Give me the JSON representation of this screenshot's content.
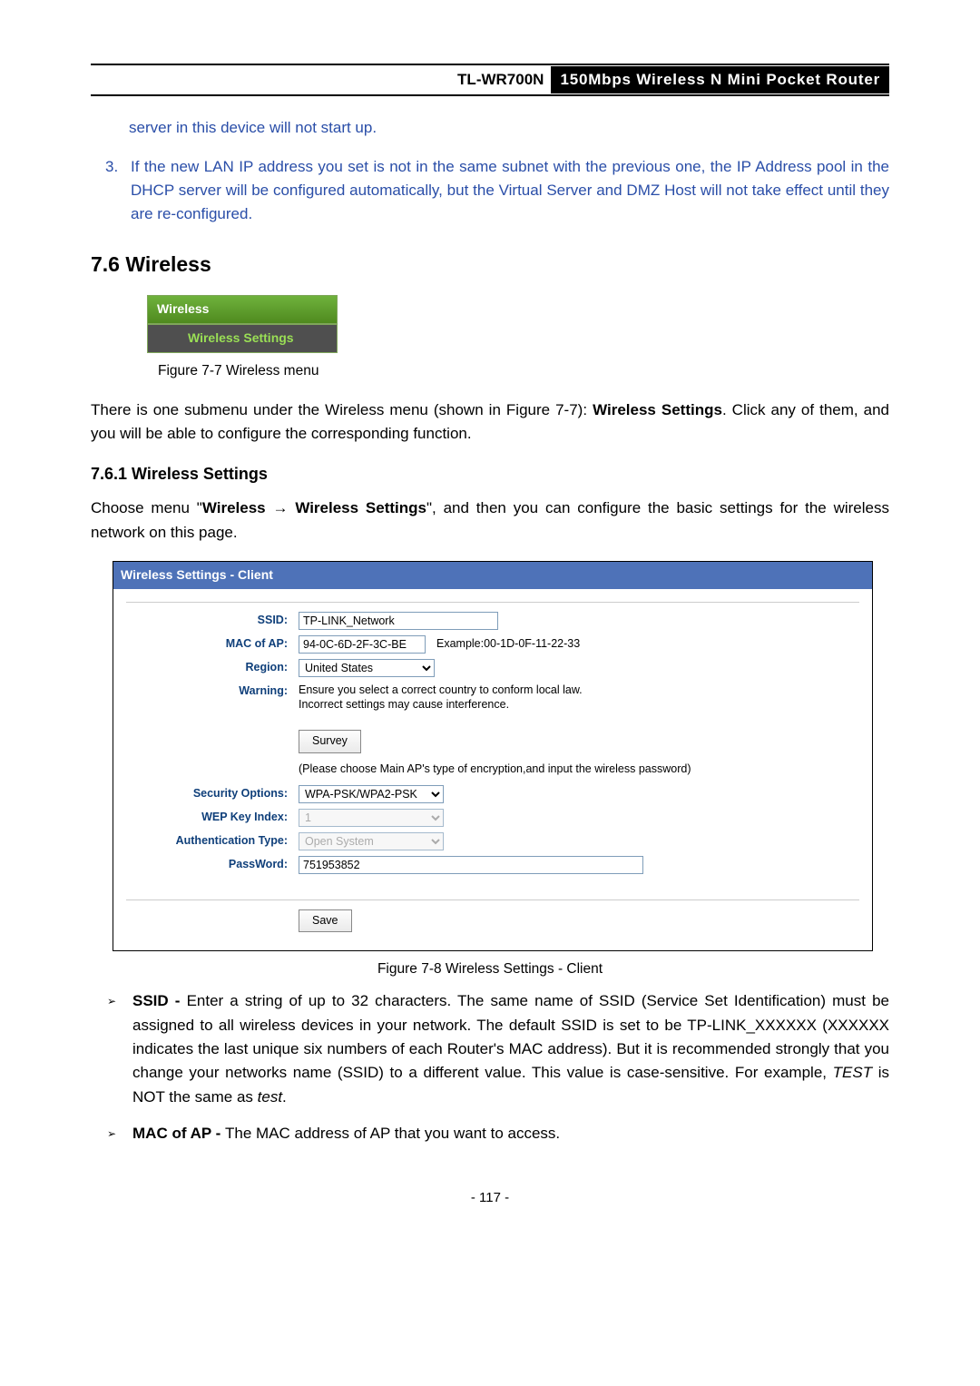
{
  "header": {
    "model": "TL-WR700N",
    "desc": "150Mbps  Wireless  N  Mini  Pocket  Router"
  },
  "note2": "server in this device will not start up.",
  "list3": {
    "num": "3.",
    "text": "If the new LAN IP address you set is not in the same subnet with the previous one, the IP Address pool in the DHCP server will be configured automatically, but the Virtual Server and DMZ Host will not take effect until they are re-configured."
  },
  "h2": "7.6  Wireless",
  "menu": {
    "wireless": "Wireless",
    "settings": "Wireless Settings"
  },
  "fig77": "Figure 7-7    Wireless menu",
  "para1_a": "There is one submenu under the Wireless menu (shown in Figure 7-7): ",
  "para1_b": "Wireless Settings",
  "para1_c": ". Click any of them, and you will be able to configure the corresponding function.",
  "h3": "7.6.1  Wireless Settings",
  "para2_a": "Choose menu \"",
  "para2_b": "Wireless",
  "para2_arrow": "  →  ",
  "para2_c": "Wireless Settings",
  "para2_d": "\", and then you can configure the basic settings for the wireless network on this page.",
  "panel": {
    "title": "Wireless Settings - Client",
    "ssid_label": "SSID:",
    "ssid_value": "TP-LINK_Network",
    "mac_label": "MAC of AP:",
    "mac_value": "94-0C-6D-2F-3C-BE",
    "mac_example": "Example:00-1D-0F-11-22-33",
    "region_label": "Region:",
    "region_value": "United States",
    "warning_label": "Warning:",
    "warning_line1": "Ensure you select a correct country to conform local law.",
    "warning_line2": "Incorrect settings may cause interference.",
    "survey_btn": "Survey",
    "hint": "(Please choose Main AP's type of encryption,and input the wireless password)",
    "sec_label": "Security Options:",
    "sec_value": "WPA-PSK/WPA2-PSK",
    "wep_label": "WEP Key Index:",
    "wep_value": "1",
    "auth_label": "Authentication Type:",
    "auth_value": "Open System",
    "pw_label": "PassWord:",
    "pw_value": "751953852",
    "save_btn": "Save"
  },
  "fig78": "Figure 7-8 Wireless Settings - Client",
  "bullets": {
    "b1_a": "SSID - ",
    "b1_b": "Enter a string of up to 32 characters. The same name of SSID (Service Set Identification) must be assigned to all wireless devices in your network. The default SSID is set to be TP-LINK_XXXXXX (XXXXXX indicates the last unique six numbers of each Router's MAC address). But it is recommended strongly that you change your networks name (SSID) to a different value. This value is case-sensitive. For example, ",
    "b1_test": "TEST",
    "b1_c": " is NOT the same as ",
    "b1_test2": "test",
    "b1_d": ".",
    "b2_a": "MAC of AP - ",
    "b2_b": "The MAC address of AP that you want to access."
  },
  "pagenum": "- 117 -"
}
